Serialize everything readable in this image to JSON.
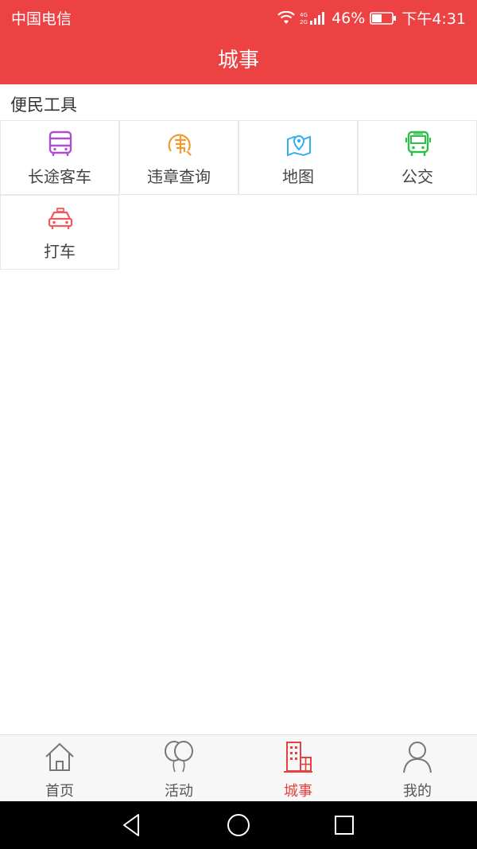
{
  "status_bar": {
    "carrier": "中国电信",
    "signal_label": "4G 2G",
    "battery": "46%",
    "time": "下午4:31"
  },
  "header": {
    "title": "城事"
  },
  "section": {
    "title": "便民工具"
  },
  "tools": [
    {
      "label": "长途客车",
      "icon": "long-distance-bus-icon",
      "color": "#a94fd0"
    },
    {
      "label": "违章查询",
      "icon": "traffic-violation-icon",
      "color": "#f39a2c"
    },
    {
      "label": "地图",
      "icon": "map-icon",
      "color": "#33aef0"
    },
    {
      "label": "公交",
      "icon": "city-bus-icon",
      "color": "#2dbf4a"
    },
    {
      "label": "打车",
      "icon": "taxi-icon",
      "color": "#f05a5a"
    }
  ],
  "tabs": [
    {
      "label": "首页",
      "icon": "home-icon"
    },
    {
      "label": "活动",
      "icon": "balloon-icon"
    },
    {
      "label": "城事",
      "icon": "building-icon",
      "active": true
    },
    {
      "label": "我的",
      "icon": "profile-icon"
    }
  ],
  "colors": {
    "accent": "#ed4244",
    "tab_active": "#e8403f"
  }
}
